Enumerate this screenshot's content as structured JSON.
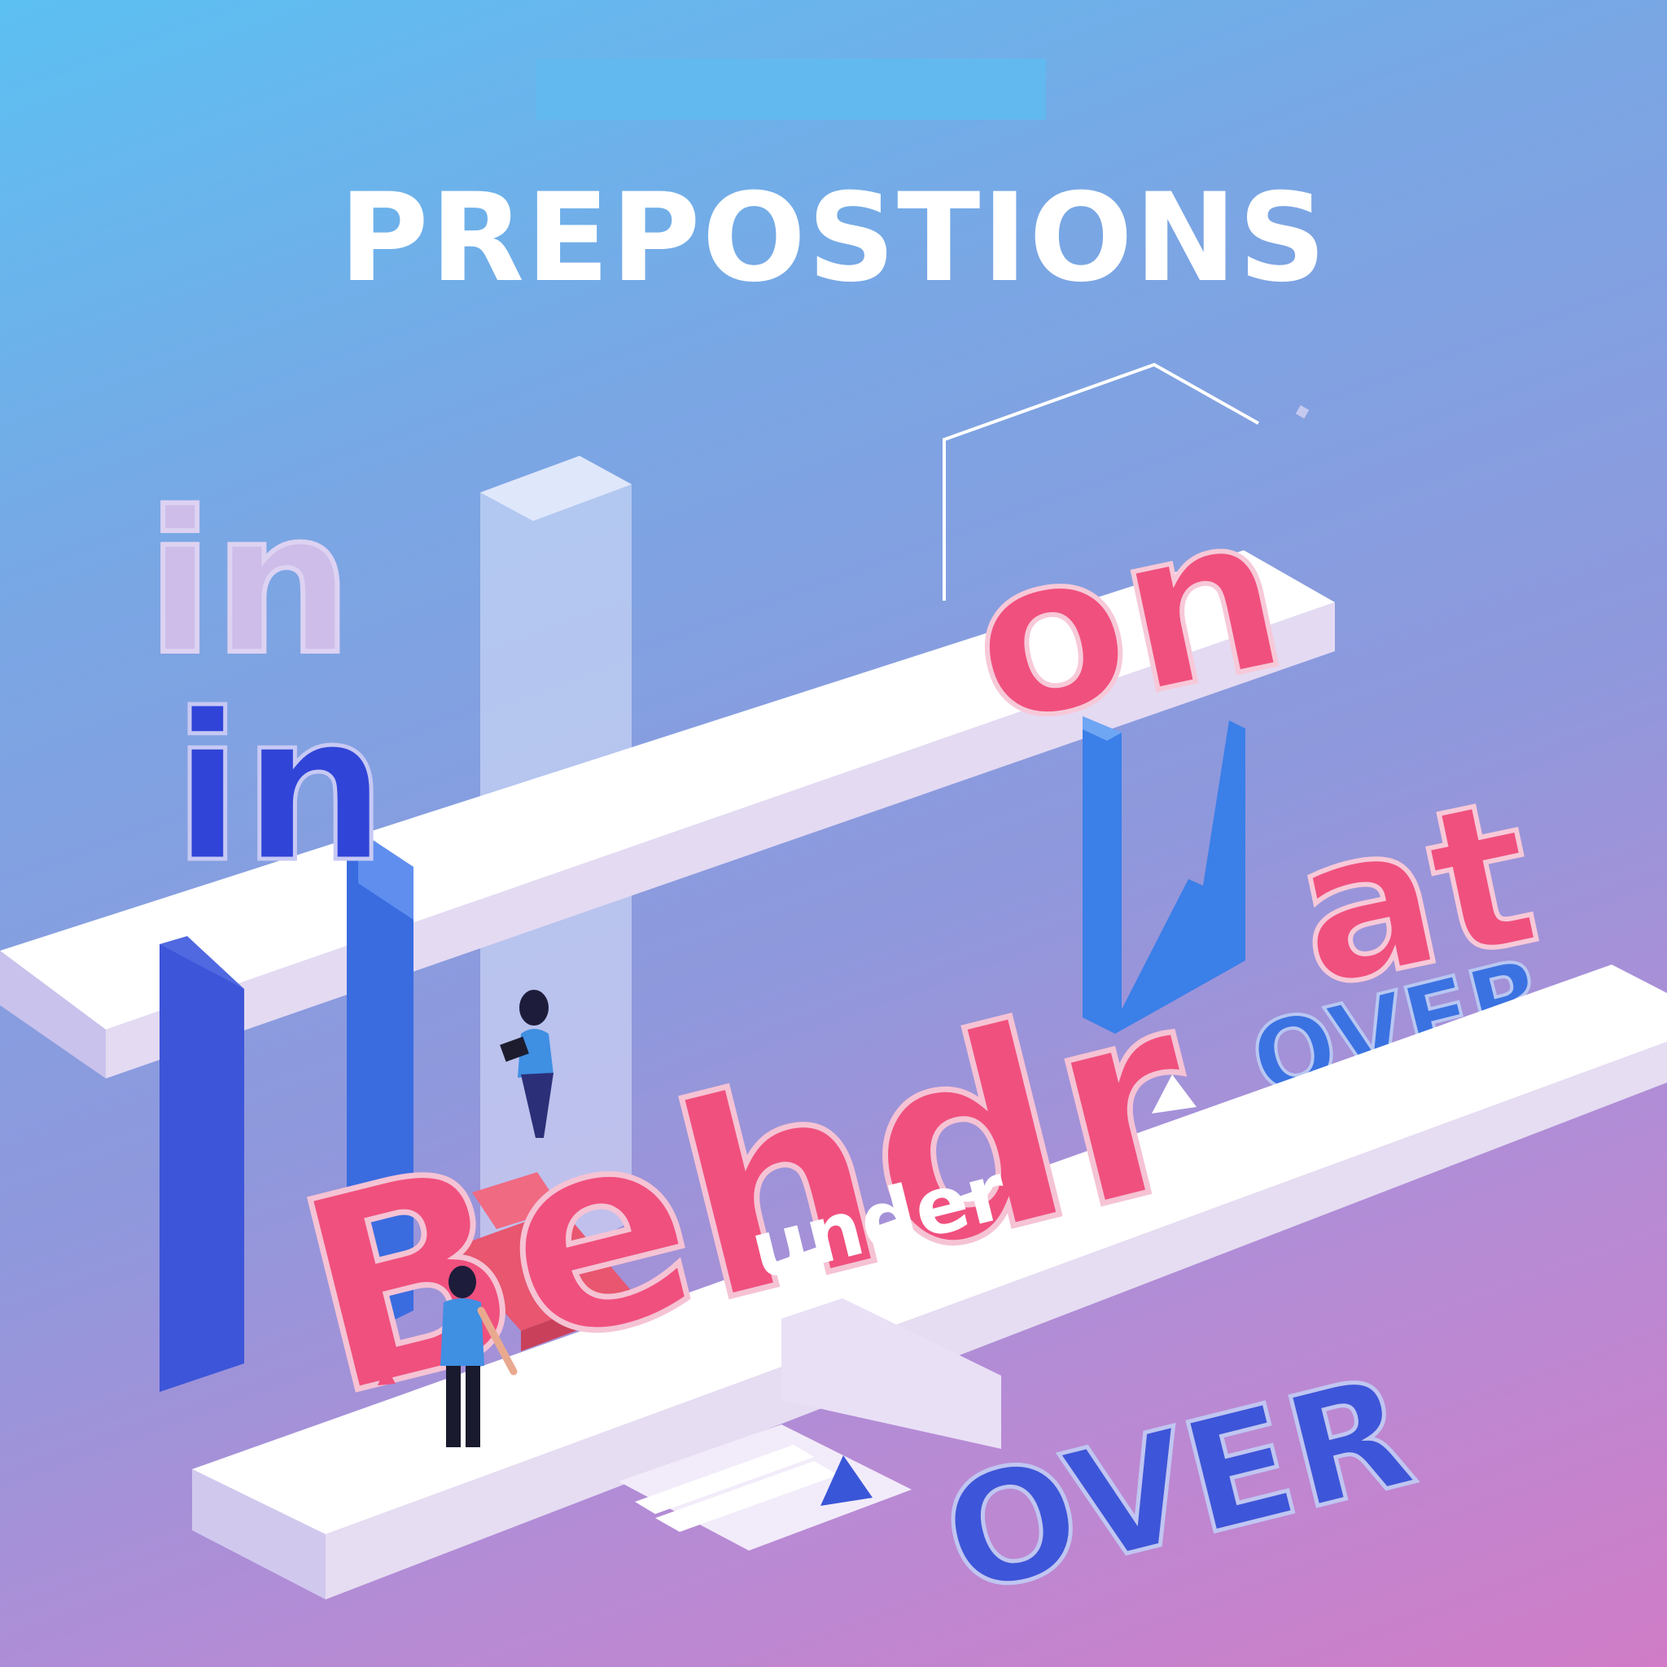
{
  "title": "PREPOSTIONS",
  "words": {
    "in_faded": "in",
    "in_main": "in",
    "on": "on",
    "at": "at",
    "behind": "Behdr",
    "under": "under",
    "over_upper": "OVER",
    "over_lower": "OVER"
  },
  "colors": {
    "background_top": "#5cc0f2",
    "background_bottom": "#d07cc6",
    "title": "#ffffff",
    "accent_pink": "#f0507e",
    "accent_blue": "#3a56d8",
    "bar_blue": "#62b9ef",
    "platform": "#ffffff"
  }
}
